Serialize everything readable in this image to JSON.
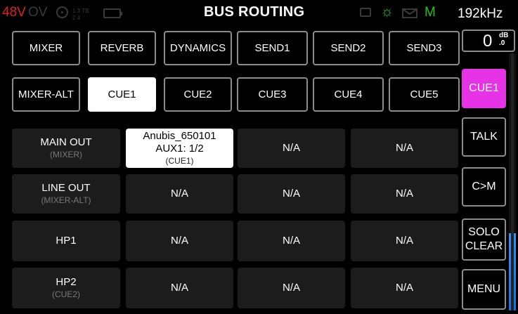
{
  "status": {
    "phantom": "48V",
    "overload": "OV",
    "inputs_top": "1  3 TB",
    "inputs_bottom": "2  4",
    "title": "BUS ROUTING",
    "mode": "M",
    "sample_rate": "192kHz"
  },
  "meter": {
    "value": "0",
    "unit": "dB",
    "decimal": ".0",
    "level": 0.3
  },
  "tabs_row1": [
    "MIXER",
    "REVERB",
    "DYNAMICS",
    "SEND1",
    "SEND2",
    "SEND3"
  ],
  "tabs_row2": [
    "MIXER-ALT",
    "CUE1",
    "CUE2",
    "CUE3",
    "CUE4",
    "CUE5"
  ],
  "active_tab": "CUE1",
  "rows": [
    {
      "label": "MAIN OUT",
      "sub": "(MIXER)",
      "cells": [
        {
          "line1": "Anubis_650101",
          "line2": "AUX1: 1/2",
          "sub": "(CUE1)"
        },
        {
          "line1": "N/A"
        },
        {
          "line1": "N/A"
        }
      ]
    },
    {
      "label": "LINE OUT",
      "sub": "(MIXER-ALT)",
      "cells": [
        {
          "line1": "N/A"
        },
        {
          "line1": "N/A"
        },
        {
          "line1": "N/A"
        },
        {
          "line1": "N/A"
        }
      ]
    },
    {
      "label": "HP1",
      "sub": "",
      "cells": [
        {
          "line1": "N/A"
        },
        {
          "line1": "N/A"
        },
        {
          "line1": "N/A"
        },
        {
          "line1": "N/A"
        }
      ]
    },
    {
      "label": "HP2",
      "sub": "(CUE2)",
      "cells": [
        {
          "line1": "N/A"
        },
        {
          "line1": "N/A"
        },
        {
          "line1": "N/A"
        },
        {
          "line1": "N/A"
        }
      ]
    }
  ],
  "side": {
    "cue": "CUE1",
    "talk": "TALK",
    "cm": "C>M",
    "solo_line1": "SOLO",
    "solo_line2": "CLEAR",
    "menu": "MENU"
  },
  "colors": {
    "phantom_red": "#e0201c",
    "mode_green": "#1fc41f",
    "cue_magenta": "#e633e6",
    "meter_blue": "#1e6fd9"
  }
}
